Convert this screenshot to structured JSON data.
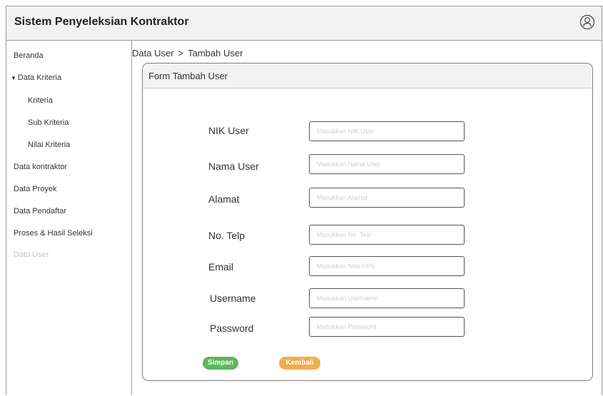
{
  "app": {
    "title": "Sistem Penyeleksian Kontraktor"
  },
  "sidebar": {
    "items": [
      {
        "label": "Beranda"
      },
      {
        "label": "Data Kriteria"
      },
      {
        "label": "Kriteria"
      },
      {
        "label": "Sub Kriteria"
      },
      {
        "label": "Nilai Kriteria"
      },
      {
        "label": "Data kontraktor"
      },
      {
        "label": "Data Proyek"
      },
      {
        "label": "Data Pendaftar"
      },
      {
        "label": "Proses & Hasil Seleksi"
      },
      {
        "label": "Data User"
      }
    ]
  },
  "breadcrumb": {
    "parent": "Data User",
    "separator": ">",
    "current": "Tambah User"
  },
  "form": {
    "title": "Form Tambah User",
    "fields": [
      {
        "label": "NIK User",
        "placeholder": "Masukkan NIK User"
      },
      {
        "label": "Nama User",
        "placeholder": "Masukkan Nama User"
      },
      {
        "label": "Alamat",
        "placeholder": "Masukkan Alamat"
      },
      {
        "label": "No. Telp",
        "placeholder": "Masukkan No. Telp"
      },
      {
        "label": "Email",
        "placeholder": "Masukkan Nilai HPS"
      },
      {
        "label": "Username",
        "placeholder": "Masukkan Username"
      },
      {
        "label": "Password",
        "placeholder": "Masukkan Password"
      }
    ],
    "save_label": "Simpan",
    "back_label": "Kembali"
  },
  "colors": {
    "save": "#5cb85c",
    "back": "#f0ad4e",
    "header_bg": "#f2f2f2",
    "border": "#9a9a9a",
    "disabled_text": "#c4c4c4"
  },
  "icons": {
    "user": "user-circle-icon",
    "caret": "caret-down-icon"
  }
}
